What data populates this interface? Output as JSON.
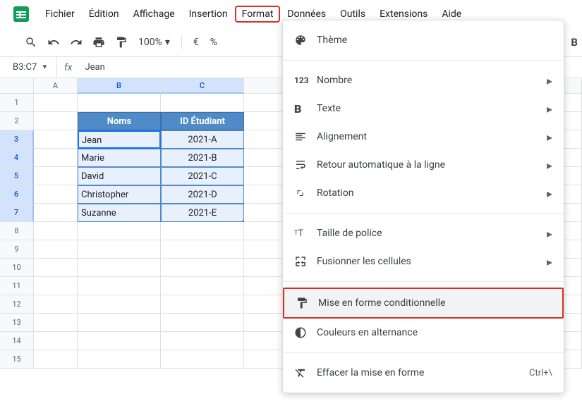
{
  "menu": {
    "items": [
      "Fichier",
      "Édition",
      "Affichage",
      "Insertion",
      "Format",
      "Données",
      "Outils",
      "Extensions",
      "Aide"
    ]
  },
  "toolbar": {
    "zoom": "100%",
    "currency": "€",
    "percent": "%",
    "bold": "B"
  },
  "formula": {
    "name_box": "B3:C7",
    "fx_label": "fx",
    "value": "Jean"
  },
  "columns": [
    "A",
    "B",
    "C"
  ],
  "row_numbers": [
    1,
    2,
    3,
    4,
    5,
    6,
    7,
    8,
    9,
    10,
    11,
    12,
    13,
    14,
    15
  ],
  "table": {
    "headers": [
      "Noms",
      "ID Étudiant"
    ],
    "rows": [
      {
        "name": "Jean",
        "id": "2021-A"
      },
      {
        "name": "Marie",
        "id": "2021-B"
      },
      {
        "name": "David",
        "id": "2021-C"
      },
      {
        "name": "Christopher",
        "id": "2021-D"
      },
      {
        "name": "Suzanne",
        "id": "2021-E"
      }
    ]
  },
  "dropdown": {
    "theme": "Thème",
    "number": "Nombre",
    "text": "Texte",
    "alignment": "Alignement",
    "wrap": "Retour automatique à la ligne",
    "rotation": "Rotation",
    "fontsize": "Taille de police",
    "merge": "Fusionner les cellules",
    "conditional": "Mise en forme conditionnelle",
    "alternating": "Couleurs en alternance",
    "clear": "Effacer la mise en forme",
    "clear_shortcut": "Ctrl+\\"
  }
}
